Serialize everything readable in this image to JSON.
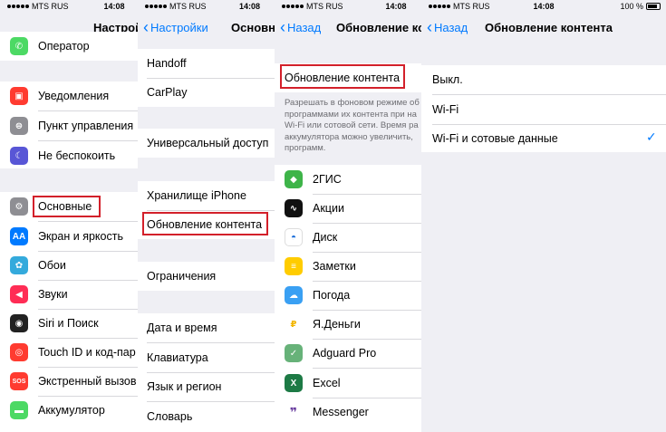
{
  "status": {
    "carrier": "MTS RUS",
    "time": "14:08",
    "battery": "100 %"
  },
  "panel1": {
    "title": "Настрой",
    "items": {
      "operator": "Оператор",
      "notifications": "Уведомления",
      "control_center": "Пункт управления",
      "dnd": "Не беспокоить",
      "general": "Основные",
      "display": "Экран и яркость",
      "wallpaper": "Обои",
      "sounds": "Звуки",
      "siri": "Siri и Поиск",
      "touchid": "Touch ID и код-пар",
      "sos": "Экстренный вызов",
      "battery": "Аккумулятор"
    }
  },
  "panel2": {
    "back": "Настройки",
    "title": "Основные",
    "items": {
      "handoff": "Handoff",
      "carplay": "CarPlay",
      "accessibility": "Универсальный доступ",
      "storage": "Хранилище iPhone",
      "bg_refresh": "Обновление контента",
      "restrictions": "Ограничения",
      "datetime": "Дата и время",
      "keyboard": "Клавиатура",
      "language": "Язык и регион",
      "dictionary": "Словарь"
    }
  },
  "panel3": {
    "back": "Назад",
    "title": "Обновление ко",
    "bg_refresh": "Обновление контента",
    "description": [
      "Разрешать в фоновом режиме об",
      "программами их контента при на",
      "Wi-Fi или сотовой сети. Время ра",
      "аккумулятора можно увеличить, ",
      "программ."
    ],
    "apps": {
      "2gis": "2ГИС",
      "stocks": "Акции",
      "disk": "Диск",
      "notes": "Заметки",
      "weather": "Погода",
      "yamoney": "Я.Деньги",
      "adguard": "Adguard Pro",
      "excel": "Excel",
      "messenger": "Messenger"
    }
  },
  "panel4": {
    "back": "Назад",
    "title": "Обновление контента",
    "options": {
      "off": "Выкл.",
      "wifi": "Wi-Fi",
      "wifi_cell": "Wi-Fi и сотовые данные"
    },
    "check": "✓"
  },
  "colors": {
    "tint": "#007aff",
    "highlight": "#d3202a",
    "background": "#efeff4"
  }
}
